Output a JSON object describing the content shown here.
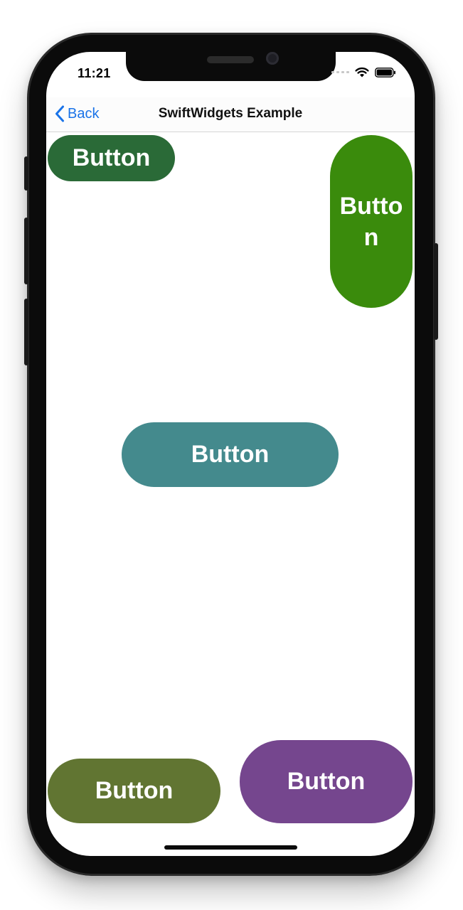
{
  "status_bar": {
    "time": "11:21"
  },
  "nav_bar": {
    "back_label": "Back",
    "title": "SwiftWidgets Example"
  },
  "buttons": {
    "top_left": {
      "label": "Button",
      "color": "#2a6a37"
    },
    "top_right": {
      "label": "Button",
      "color": "#3a8b0c"
    },
    "center": {
      "label": "Button",
      "color": "#448a8d"
    },
    "bottom_left": {
      "label": "Button",
      "color": "#617532"
    },
    "bottom_right": {
      "label": "Button",
      "color": "#75468e"
    }
  },
  "colors": {
    "accent": "#1a73e8"
  }
}
